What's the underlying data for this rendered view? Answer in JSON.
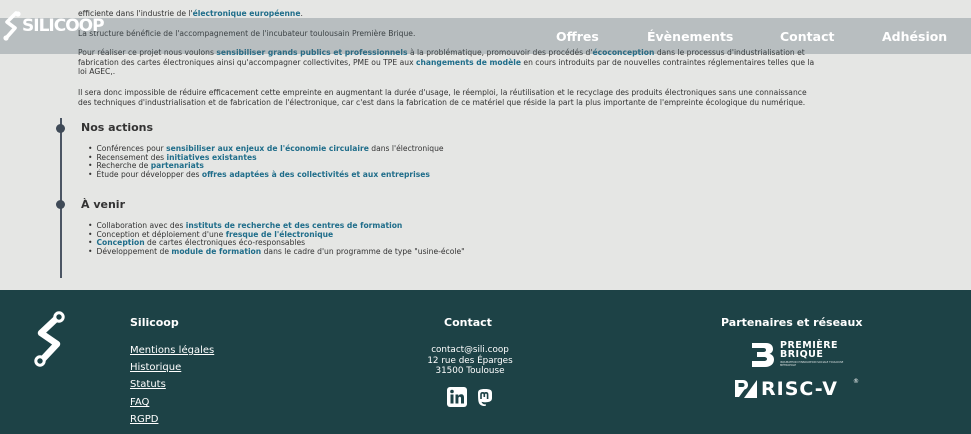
{
  "header": {
    "brand": "SILICOOP",
    "nav": [
      "Offres",
      "Évènements",
      "Contact",
      "Adhésion"
    ]
  },
  "content": {
    "line1_pre": "efficiente dans l'industrie de l'",
    "line1_hl": "électronique européenne",
    "line1_post": ".",
    "line2": "La structure bénéficie de l'accompagnement de l'incubateur toulousain Première Brique.",
    "para1_a": "Pour réaliser ce projet nous voulons ",
    "para1_hl1": "sensibiliser grands publics et professionnels",
    "para1_b": " à la problématique, promouvoir des procédés d'",
    "para1_hl2": "écoconception",
    "para1_c": " dans le processus d'industrialisation et",
    "para1_line2_a": "fabrication des cartes électroniques ainsi qu'accompagner collectivites, PME ou TPE aux ",
    "para1_line2_hl": "changements de modèle",
    "para1_line2_b": " en cours introduits par de nouvelles contraintes réglementaires telles que la",
    "para1_line3": "loi AGEC,.",
    "para2_line1": "Il sera donc impossible de réduire efficacement cette empreinte en augmentant la durée d'usage, le réemploi, la réutilisation et le recyclage des produits électroniques sans une connaissance",
    "para2_line2": "des techniques d'industrialisation et de fabrication de l'électronique, car c'est dans la fabrication de ce matériel que réside la part la plus importante de l'empreinte écologique du numérique.",
    "actions_title": "Nos actions",
    "actions": [
      {
        "pre": "Conférences pour ",
        "hl": "sensibiliser aux enjeux de l'économie circulaire",
        "post": " dans l'électronique"
      },
      {
        "pre": "Recensement des ",
        "hl": "initiatives existantes",
        "post": ""
      },
      {
        "pre": "Recherche de ",
        "hl": "partenariats",
        "post": ""
      },
      {
        "pre": "Étude pour développer des ",
        "hl": "offres adaptées à des collectivités et aux entreprises",
        "post": ""
      }
    ],
    "future_title": "À venir",
    "future": [
      {
        "pre": "Collaboration avec des ",
        "hl": "instituts de recherche et des centres de formation",
        "post": ""
      },
      {
        "pre": "Conception et déploiement d'une ",
        "hl": "fresque de l'électronique",
        "post": ""
      },
      {
        "pre": "",
        "hl": "Conception",
        "post": " de cartes électroniques éco-responsables"
      },
      {
        "pre": "Développement de ",
        "hl": "module de formation",
        "post": " dans le cadre d'un programme de type \"usine-école\""
      }
    ]
  },
  "footer": {
    "col1_title": "Silicoop",
    "links": [
      "Mentions légales",
      "Historique",
      "Statuts",
      "FAQ",
      "RGPD"
    ],
    "col2_title": "Contact",
    "email": "contact@sili.coop",
    "address1": "12 rue des Éparges",
    "address2": "31500 Toulouse",
    "col3_title": "Partenaires et réseaux",
    "partner1_line1": "PREMIÈRE",
    "partner1_line2": "BRIQUE",
    "partner1_tagline": "INCUBATEUR D'INNOVATION SOCIALE TOULOUSE MÉTROPOLE",
    "partner2": "RISC-V",
    "partner2_mark": "®"
  },
  "colors": {
    "highlight": "#1f6d8a",
    "footer_bg": "#1d4246",
    "page_bg": "#e5e6e4"
  },
  "icons": [
    "silicoop-logo-icon",
    "linkedin-icon",
    "mastodon-icon",
    "premiere-brique-logo-icon",
    "risc-v-logo-icon"
  ]
}
